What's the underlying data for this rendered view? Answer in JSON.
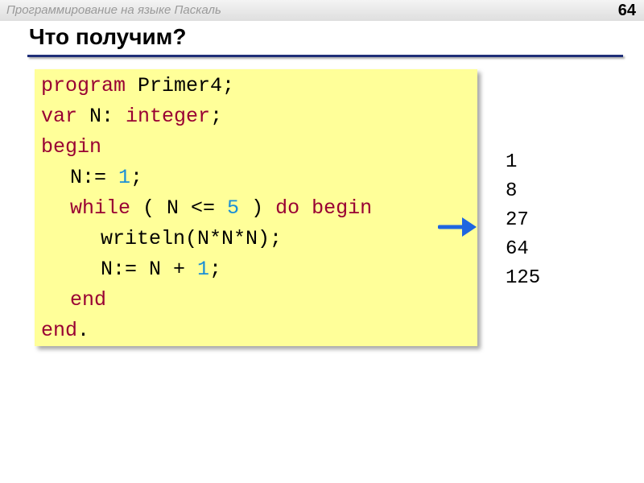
{
  "header": {
    "subject": "Программирование на языке Паскаль",
    "slide_number": "64"
  },
  "title": "Что получим?",
  "code": {
    "line1": {
      "kw_program": "program",
      "name": " Primer4;"
    },
    "line2": {
      "kw_var": "var",
      "decl": " N: ",
      "kw_type": "integer",
      "semi": ";"
    },
    "line3": {
      "kw_begin": "begin"
    },
    "line4": {
      "assign": "N:= ",
      "value": "1",
      "semi": ";"
    },
    "line5": {
      "kw_while": "while",
      "cond_open": " ( N <= ",
      "limit": "5",
      "cond_close": " ) ",
      "kw_do": "do",
      "space": " ",
      "kw_begin": "begin"
    },
    "line6": {
      "call": "writeln(N*N*N);"
    },
    "line7": {
      "expr": "N:= N + ",
      "step": "1",
      "semi": ";"
    },
    "line8": {
      "kw_end": "end"
    },
    "line9": {
      "kw_end": "end",
      "dot": "."
    }
  },
  "output": [
    "1",
    "8",
    "27",
    "64",
    "125"
  ],
  "colors": {
    "keyword": "#990033",
    "number": "#1a8fd6",
    "code_background": "#ffff99",
    "title_rule": "#1f2f78",
    "arrow": "#1f66e0"
  },
  "icons": {
    "arrow": "arrow-right-icon"
  }
}
